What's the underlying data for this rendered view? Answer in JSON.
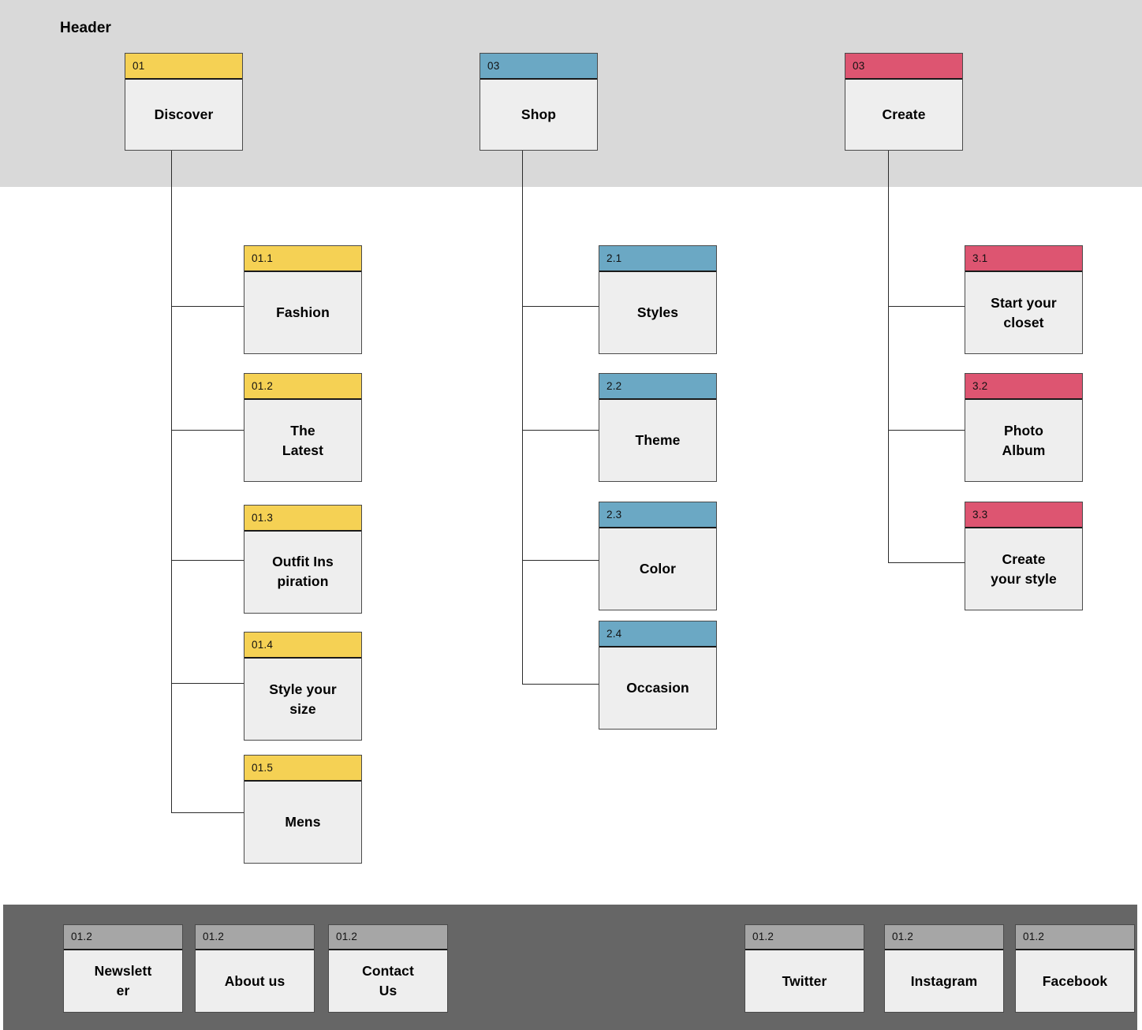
{
  "diagram": {
    "type": "sitemap",
    "header_band_label": "Header",
    "colors": {
      "yellow": "#f5d154",
      "blue": "#6ba8c4",
      "pink": "#dd5571",
      "gray": "#a6a6a6",
      "header_band": "#d9d9d9",
      "footer_band": "#666666",
      "node_body": "#eeeeee",
      "border": "#4a4a4a"
    }
  },
  "header": {
    "title": "Header",
    "nodes": [
      {
        "code": "01",
        "label": "Discover",
        "accent": "yellow"
      },
      {
        "code": "03",
        "label": "Shop",
        "accent": "blue"
      },
      {
        "code": "03",
        "label": "Create",
        "accent": "pink"
      }
    ]
  },
  "branches": {
    "discover": [
      {
        "code": "01.1",
        "label": "Fashion",
        "accent": "yellow"
      },
      {
        "code": "01.2",
        "label": "The Latest",
        "accent": "yellow"
      },
      {
        "code": "01.3",
        "label": "Outfit Inspiration",
        "accent": "yellow"
      },
      {
        "code": "01.4",
        "label": "Style your size",
        "accent": "yellow"
      },
      {
        "code": "01.5",
        "label": "Mens",
        "accent": "yellow"
      }
    ],
    "shop": [
      {
        "code": "2.1",
        "label": "Styles",
        "accent": "blue"
      },
      {
        "code": "2.2",
        "label": "Theme",
        "accent": "blue"
      },
      {
        "code": "2.3",
        "label": "Color",
        "accent": "blue"
      },
      {
        "code": "2.4",
        "label": "Occasion",
        "accent": "blue"
      }
    ],
    "create": [
      {
        "code": "3.1",
        "label": "Start your closet",
        "accent": "pink"
      },
      {
        "code": "3.2",
        "label": "Photo Album",
        "accent": "pink"
      },
      {
        "code": "3.3",
        "label": "Create your style",
        "accent": "pink"
      }
    ]
  },
  "footer": {
    "links": [
      {
        "code": "01.2",
        "label": "Newsletter",
        "accent": "gray"
      },
      {
        "code": "01.2",
        "label": "About us",
        "accent": "gray"
      },
      {
        "code": "01.2",
        "label": "Contact Us",
        "accent": "gray"
      }
    ],
    "social": [
      {
        "code": "01.2",
        "label": "Twitter",
        "accent": "gray"
      },
      {
        "code": "01.2",
        "label": "Instagram",
        "accent": "gray"
      },
      {
        "code": "01.2",
        "label": "Facebook",
        "accent": "gray"
      }
    ]
  }
}
